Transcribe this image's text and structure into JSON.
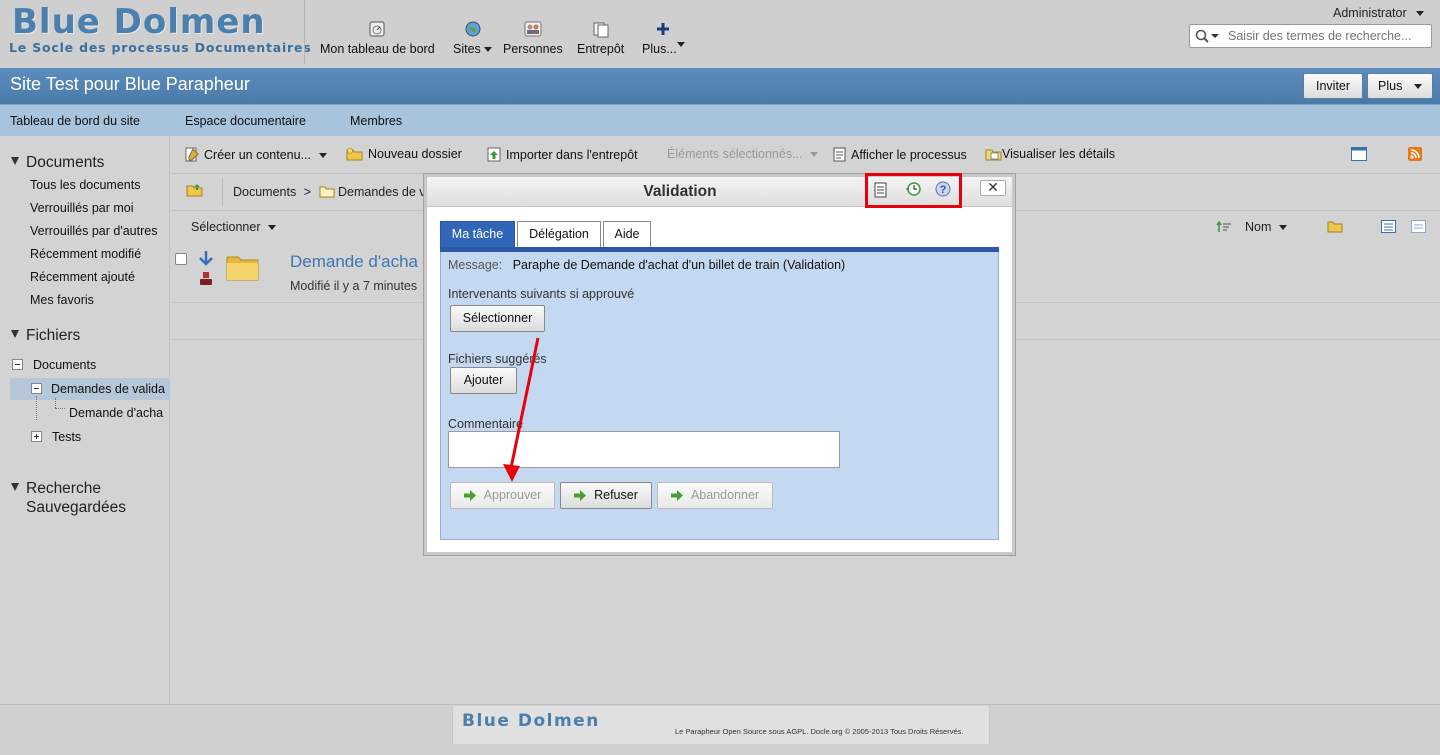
{
  "brand": {
    "title": "Blue Dolmen",
    "subtitle": "Le Socle des processus Documentaires"
  },
  "nav": {
    "items": [
      {
        "label": "Mon tableau de bord",
        "icon": "dashboard-icon"
      },
      {
        "label": "Sites",
        "icon": "globe-icon"
      },
      {
        "label": "Personnes",
        "icon": "people-icon"
      },
      {
        "label": "Entrepôt",
        "icon": "repository-icon"
      },
      {
        "label": "Plus...",
        "icon": "plus-icon"
      }
    ],
    "user": "Administrator",
    "search_placeholder": "Saisir des termes de recherche..."
  },
  "site": {
    "title": "Site Test pour Blue Parapheur",
    "invite_label": "Inviter",
    "more_label": "Plus",
    "tabs": [
      "Tableau de bord du site",
      "Espace documentaire",
      "Membres"
    ]
  },
  "sidebar": {
    "documents_heading": "Documents",
    "document_links": [
      "Tous les documents",
      "Verrouillés par moi",
      "Verrouillés par d'autres",
      "Récemment modifié",
      "Récemment ajouté",
      "Mes favoris"
    ],
    "files_heading": "Fichiers",
    "tree": {
      "root": "Documents",
      "child_selected": "Demandes de valida",
      "grandchild": "Demande d'acha",
      "child2": "Tests"
    },
    "saved_search_heading_line1": "Recherche",
    "saved_search_heading_line2": "Sauvegardées"
  },
  "toolbar": {
    "create": "Créer un contenu...",
    "new_folder": "Nouveau dossier",
    "import": "Importer dans l'entrepôt",
    "selected_items": "Éléments sélectionnés...",
    "show_process": "Afficher le processus",
    "show_details": "Visualiser les détails"
  },
  "breadcrumb": {
    "root": "Documents",
    "separator": ">",
    "current": "Demandes de v"
  },
  "list": {
    "select_label": "Sélectionner",
    "sort_label": "Nom",
    "item_title": "Demande d'acha",
    "item_meta": "Modifié il y a 7 minutes"
  },
  "dialog": {
    "title": "Validation",
    "close": "✕",
    "tabs": [
      "Ma tâche",
      "Délégation",
      "Aide"
    ],
    "message_label": "Message:",
    "message_value": "Paraphe de Demande d'achat d'un billet de train (Validation)",
    "next_label": "Intervenants suivants si approuvé",
    "select_button": "Sélectionner",
    "files_label": "Fichiers suggérés",
    "add_button": "Ajouter",
    "comment_label": "Commentaire",
    "comment_value": "",
    "approve": "Approuver",
    "refuse": "Refuser",
    "abandon": "Abandonner"
  },
  "footer": {
    "logo": "Blue Dolmen",
    "text": "Le Parapheur Open Source sous AGPL. Docle.org © 2005-2013 Tous Droits Réservés."
  },
  "colors": {
    "brand_blue": "#4a7fae",
    "site_bar": "#5b8dbd",
    "active_tab": "#3066b7",
    "panel": "#c5d8f1",
    "highlight_red": "#e8000b",
    "arrow_green": "#4aa02c"
  }
}
